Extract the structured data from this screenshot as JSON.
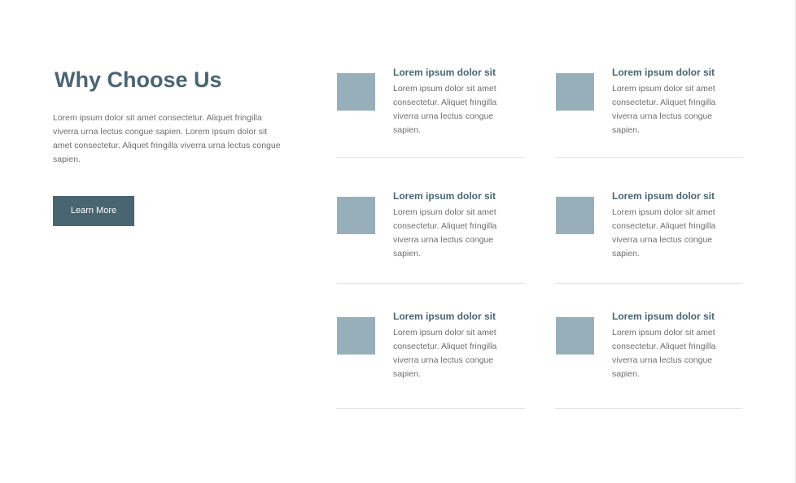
{
  "section": {
    "title": "Why Choose Us",
    "description": "Lorem ipsum dolor sit amet consectetur. Aliquet fringilla viverra urna lectus congue sapien. Lorem ipsum dolor sit amet consectetur. Aliquet fringilla viverra urna lectus congue sapien.",
    "button_label": "Learn More"
  },
  "features": [
    {
      "title": "Lorem ipsum dolor sit",
      "text": "Lorem ipsum dolor sit amet consectetur. Aliquet fringilla viverra urna lectus congue sapien."
    },
    {
      "title": "Lorem ipsum dolor sit",
      "text": "Lorem ipsum dolor sit amet consectetur. Aliquet fringilla viverra urna lectus congue sapien."
    },
    {
      "title": "Lorem ipsum dolor sit",
      "text": "Lorem ipsum dolor sit amet consectetur. Aliquet fringilla viverra urna lectus congue sapien."
    },
    {
      "title": "Lorem ipsum dolor sit",
      "text": "Lorem ipsum dolor sit amet consectetur. Aliquet fringilla viverra urna lectus congue sapien."
    },
    {
      "title": "Lorem ipsum dolor sit",
      "text": "Lorem ipsum dolor sit amet consectetur. Aliquet fringilla viverra urna lectus congue sapien."
    },
    {
      "title": "Lorem ipsum dolor sit",
      "text": "Lorem ipsum dolor sit amet consectetur. Aliquet fringilla viverra urna lectus congue sapien."
    }
  ],
  "colors": {
    "heading": "#4a6572",
    "button_bg": "#4a6572",
    "button_text": "#ffffff",
    "thumbnail": "#97afba",
    "body_text": "#6e6e6e",
    "divider": "#e4e4e4"
  }
}
